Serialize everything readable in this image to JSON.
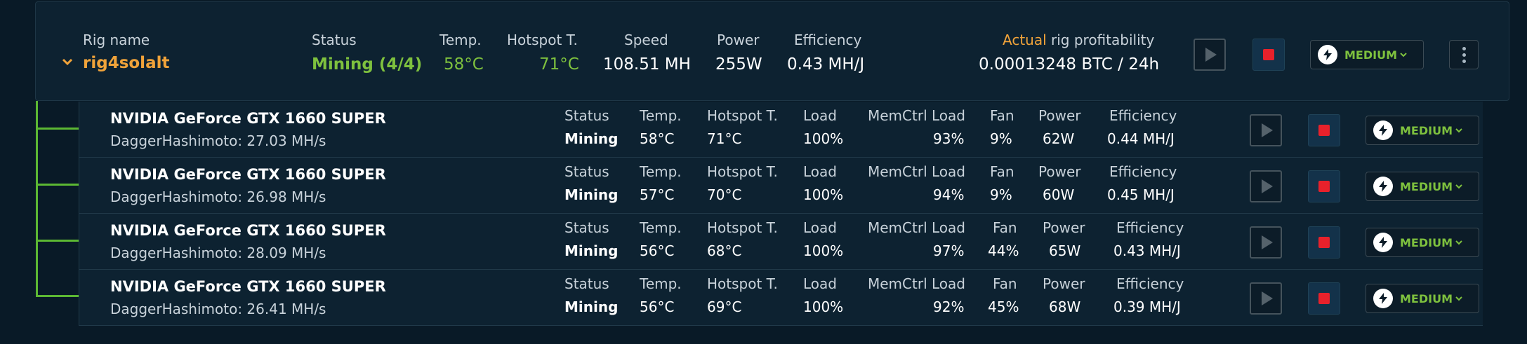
{
  "rig": {
    "name_label": "Rig name",
    "name": "rig4solalt",
    "status_label": "Status",
    "status": "Mining (4/4)",
    "temp_label": "Temp.",
    "temp": "58°C",
    "hotspot_label": "Hotspot T.",
    "hotspot": "71°C",
    "speed_label": "Speed",
    "speed": "108.51 MH",
    "power_label": "Power",
    "power": "255W",
    "efficiency_label": "Efficiency",
    "efficiency": "0.43 MH/J",
    "profit_label_accent": "Actual",
    "profit_label_rest": " rig profitability",
    "profit": "0.00013248 BTC / 24h",
    "mode": "MEDIUM"
  },
  "labels": {
    "status": "Status",
    "temp": "Temp.",
    "hotspot": "Hotspot T.",
    "load": "Load",
    "memctrl": "MemCtrl Load",
    "fan": "Fan",
    "power": "Power",
    "efficiency": "Efficiency"
  },
  "devices": [
    {
      "name": "NVIDIA GeForce GTX 1660 SUPER",
      "algo": "DaggerHashimoto: 27.03 MH/s",
      "status": "Mining",
      "temp": "58°C",
      "hotspot": "71°C",
      "load": "100%",
      "memctrl": "93%",
      "fan": "9%",
      "power": "62W",
      "efficiency": "0.44 MH/J",
      "mode": "MEDIUM"
    },
    {
      "name": "NVIDIA GeForce GTX 1660 SUPER",
      "algo": "DaggerHashimoto: 26.98 MH/s",
      "status": "Mining",
      "temp": "57°C",
      "hotspot": "70°C",
      "load": "100%",
      "memctrl": "94%",
      "fan": "9%",
      "power": "60W",
      "efficiency": "0.45 MH/J",
      "mode": "MEDIUM"
    },
    {
      "name": "NVIDIA GeForce GTX 1660 SUPER",
      "algo": "DaggerHashimoto: 28.09 MH/s",
      "status": "Mining",
      "temp": "56°C",
      "hotspot": "68°C",
      "load": "100%",
      "memctrl": "97%",
      "fan": "44%",
      "power": "65W",
      "efficiency": "0.43 MH/J",
      "mode": "MEDIUM"
    },
    {
      "name": "NVIDIA GeForce GTX 1660 SUPER",
      "algo": "DaggerHashimoto: 26.41 MH/s",
      "status": "Mining",
      "temp": "56°C",
      "hotspot": "69°C",
      "load": "100%",
      "memctrl": "92%",
      "fan": "45%",
      "power": "68W",
      "efficiency": "0.39 MH/J",
      "mode": "MEDIUM"
    }
  ],
  "colors": {
    "accent_green": "#7ec13e",
    "accent_orange": "#f0a33a",
    "stop_red": "#e8212b"
  }
}
